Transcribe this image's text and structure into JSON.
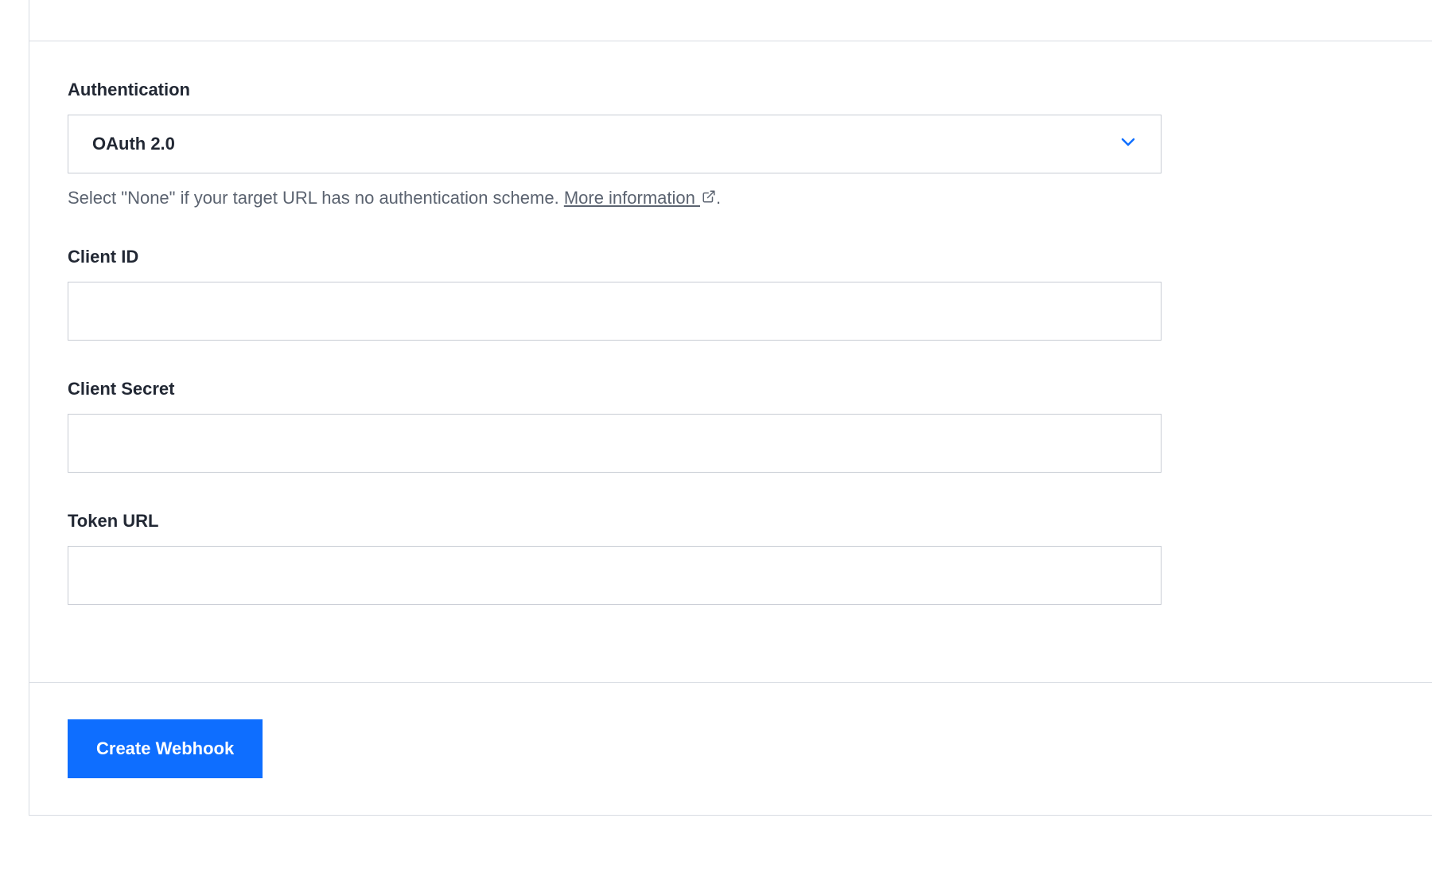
{
  "form": {
    "authentication": {
      "label": "Authentication",
      "selected": "OAuth 2.0",
      "help_text_prefix": "Select \"None\" if your target URL has no authentication scheme. ",
      "help_link_text": "More information ",
      "help_text_suffix": "."
    },
    "client_id": {
      "label": "Client ID",
      "value": ""
    },
    "client_secret": {
      "label": "Client Secret",
      "value": ""
    },
    "token_url": {
      "label": "Token URL",
      "value": ""
    }
  },
  "actions": {
    "submit_label": "Create Webhook"
  },
  "colors": {
    "primary": "#0e6eff",
    "border": "#c8ccd4",
    "text": "#222834",
    "help": "#5b6370"
  }
}
